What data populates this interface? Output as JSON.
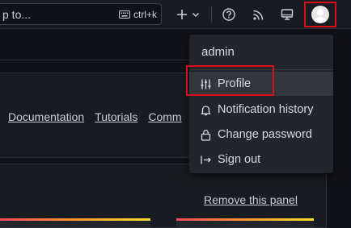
{
  "topbar": {
    "search_text": "p to...",
    "shortcut_label": "ctrl+k",
    "icons": {
      "keyboard": "keyboard-icon",
      "new": "plus-icon",
      "new_caret": "chevron-down-icon",
      "help": "help-circle-icon",
      "news": "rss-icon",
      "kiosk": "monitor-icon",
      "profile": "user-avatar"
    }
  },
  "page": {
    "links": [
      "Documentation",
      "Tutorials",
      "Comm"
    ],
    "remove_panel_label": "Remove this panel"
  },
  "profile_menu": {
    "username": "admin",
    "items": [
      {
        "label": "Profile",
        "icon": "sliders-icon",
        "hovered": true
      },
      {
        "label": "Notification history",
        "icon": "bell-icon"
      },
      {
        "label": "Change password",
        "icon": "lock-icon"
      },
      {
        "label": "Sign out",
        "icon": "sign-out-icon"
      }
    ]
  },
  "colors": {
    "highlight": "#d8101b",
    "background": "#111217",
    "menu_background": "#22252b",
    "hover_background": "#33363d"
  }
}
